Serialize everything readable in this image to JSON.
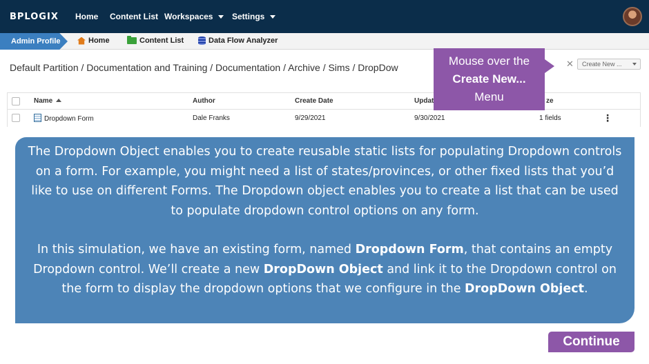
{
  "topnav": {
    "logo": "BPLOGIX",
    "items": [
      {
        "label": "Home"
      },
      {
        "label": "Content List"
      },
      {
        "label": "Workspaces"
      },
      {
        "label": "Settings"
      }
    ]
  },
  "subbar": {
    "profile": "Admin Profile",
    "items": [
      {
        "label": "Home"
      },
      {
        "label": "Content List"
      },
      {
        "label": "Data Flow Analyzer"
      }
    ]
  },
  "breadcrumb": "Default Partition / Documentation and Training / Documentation / Archive / Sims / DropDow",
  "create_new": "Create New ...",
  "table": {
    "headers": [
      "Name",
      "Author",
      "Create Date",
      "Updat",
      "ze"
    ],
    "rows": [
      {
        "name": "Dropdown Form",
        "author": "Dale Franks",
        "create_date": "9/29/2021",
        "update_date": "9/30/2021",
        "size": "1 fields"
      }
    ]
  },
  "callout": {
    "line1": "Mouse over the",
    "line2": "Create New...",
    "line3": "Menu"
  },
  "info": {
    "p1": "The Dropdown Object enables you to create reusable static lists for populating Dropdown controls on a form.   For example, you might need a list of states/provinces, or other fixed lists that you’d like to use on different Forms. The Dropdown object enables you to create a list that can be used to populate dropdown control options on any form.",
    "p2_a": "In this simulation, we have an existing form, named ",
    "p2_b": "Dropdown Form",
    "p2_c": ", that contains an empty Dropdown control. We’ll create a new ",
    "p2_d": "DropDown Object",
    "p2_e": " and link it to the Dropdown control on the form to display the dropdown options that we configure in the ",
    "p2_f": "DropDown Object",
    "p2_g": "."
  },
  "continue_label": "Continue"
}
